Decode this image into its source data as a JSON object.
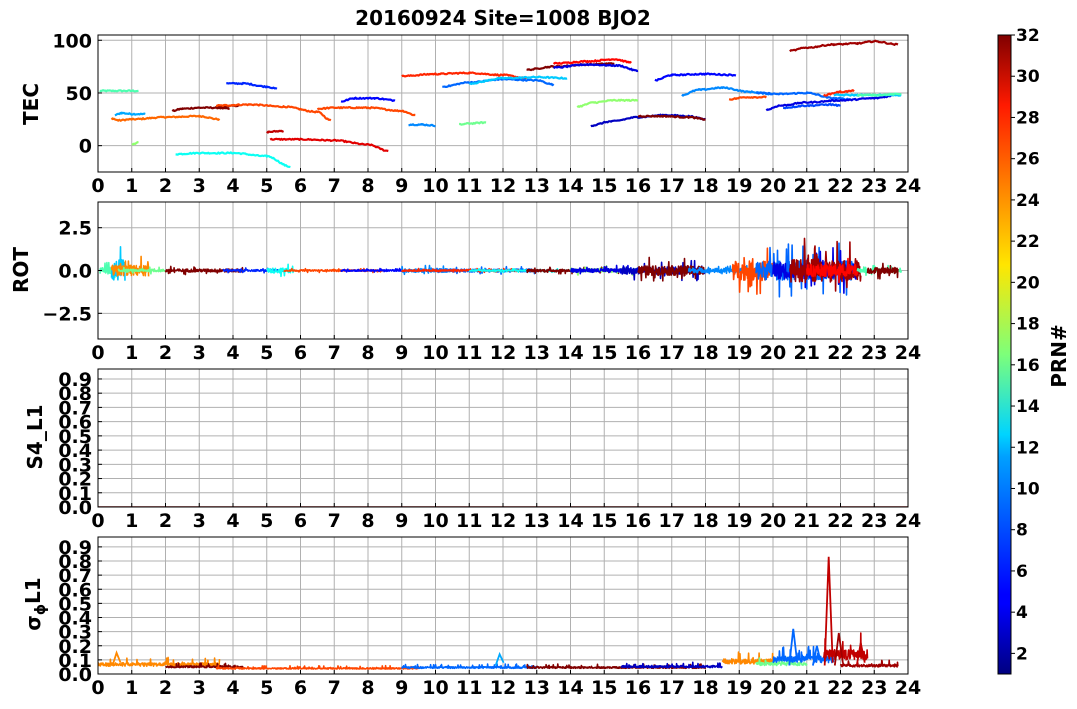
{
  "title": "20160924 Site=1008 BJO2",
  "colorbar": {
    "label": "PRN#",
    "ticks": [
      "2",
      "4",
      "6",
      "8",
      "10",
      "12",
      "14",
      "16",
      "18",
      "20",
      "22",
      "24",
      "26",
      "28",
      "30",
      "32"
    ],
    "range": [
      1,
      32
    ],
    "colormap": "jet"
  },
  "chart_data": [
    {
      "type": "line",
      "ylabel": "TEC",
      "xlim": [
        0,
        24
      ],
      "ylim": [
        -25,
        105
      ],
      "x_ticks": [
        "0",
        "1",
        "2",
        "3",
        "4",
        "5",
        "6",
        "7",
        "8",
        "9",
        "10",
        "11",
        "12",
        "13",
        "14",
        "15",
        "16",
        "17",
        "18",
        "19",
        "20",
        "21",
        "22",
        "23",
        "24"
      ],
      "y_ticks": [
        {
          "v": 0,
          "t": "0"
        },
        {
          "v": 50,
          "t": "50"
        },
        {
          "v": 100,
          "t": "100"
        }
      ],
      "grid": true,
      "series": [
        {
          "prn": 15,
          "x": [
            0.05,
            1.2
          ],
          "y": [
            52,
            52
          ]
        },
        {
          "prn": 17,
          "x": [
            1.0,
            1.2
          ],
          "y": [
            1,
            3
          ]
        },
        {
          "prn": 10,
          "x": [
            0.5,
            0.7,
            1.0,
            1.4
          ],
          "y": [
            29,
            31,
            30,
            30
          ]
        },
        {
          "prn": 25,
          "x": [
            0.4,
            0.6,
            1.0,
            2.0,
            3.0,
            3.6
          ],
          "y": [
            26,
            24,
            25,
            27,
            28,
            25
          ]
        },
        {
          "prn": 32,
          "x": [
            2.2,
            2.5,
            3.0,
            3.5,
            3.9
          ],
          "y": [
            33,
            35,
            36,
            36,
            35
          ]
        },
        {
          "prn": 32,
          "x": [
            3.5,
            4.2
          ],
          "y": [
            37,
            38
          ]
        },
        {
          "prn": 26,
          "x": [
            3.5,
            4.5,
            5.5,
            6.5,
            6.9
          ],
          "y": [
            38,
            39,
            37,
            32,
            24
          ]
        },
        {
          "prn": 13,
          "x": [
            2.3,
            3.0,
            4.0,
            5.0,
            5.7
          ],
          "y": [
            -8,
            -7,
            -7,
            -10,
            -20
          ]
        },
        {
          "prn": 6,
          "x": [
            3.8,
            4.3,
            5.0,
            5.3
          ],
          "y": [
            59,
            59,
            56,
            54
          ]
        },
        {
          "prn": 30,
          "x": [
            5.0,
            5.5
          ],
          "y": [
            13,
            14
          ]
        },
        {
          "prn": 29,
          "x": [
            5.1,
            6.0,
            7.0,
            8.0,
            8.6
          ],
          "y": [
            6,
            6,
            5,
            1,
            -5
          ]
        },
        {
          "prn": 26,
          "x": [
            6.5,
            7.0,
            8.0,
            9.0,
            9.4
          ],
          "y": [
            35,
            36,
            36,
            33,
            29
          ]
        },
        {
          "prn": 5,
          "x": [
            7.2,
            7.6,
            8.2,
            8.8
          ],
          "y": [
            42,
            45,
            45,
            43
          ]
        },
        {
          "prn": 9,
          "x": [
            9.2,
            9.6,
            10.0
          ],
          "y": [
            20,
            20,
            19
          ]
        },
        {
          "prn": 27,
          "x": [
            9.0,
            10.0,
            11.0,
            12.0,
            12.7
          ],
          "y": [
            66,
            68,
            69,
            67,
            64
          ]
        },
        {
          "prn": 16,
          "x": [
            10.7,
            11.0,
            11.5
          ],
          "y": [
            20,
            21,
            22
          ]
        },
        {
          "prn": 8,
          "x": [
            10.2,
            11.0,
            12.0,
            13.0,
            13.5
          ],
          "y": [
            56,
            60,
            63,
            62,
            58
          ]
        },
        {
          "prn": 11,
          "x": [
            11.0,
            12.0,
            13.0,
            13.9
          ],
          "y": [
            59,
            64,
            65,
            64
          ]
        },
        {
          "prn": 32,
          "x": [
            12.7,
            13.5,
            14.5,
            15.3
          ],
          "y": [
            72,
            75,
            77,
            78
          ]
        },
        {
          "prn": 28,
          "x": [
            13.5,
            14.5,
            15.3,
            15.8
          ],
          "y": [
            78,
            80,
            82,
            79
          ]
        },
        {
          "prn": 4,
          "x": [
            13.5,
            14.5,
            15.4,
            16.0
          ],
          "y": [
            74,
            77,
            76,
            71
          ]
        },
        {
          "prn": 17,
          "x": [
            14.2,
            14.7,
            15.3,
            16.0
          ],
          "y": [
            37,
            41,
            43,
            43
          ]
        },
        {
          "prn": 3,
          "x": [
            14.6,
            15.2,
            16.0,
            16.8,
            17.5,
            18.0
          ],
          "y": [
            19,
            23,
            27,
            29,
            28,
            25
          ]
        },
        {
          "prn": 32,
          "x": [
            16.0,
            16.7,
            17.5,
            18.0
          ],
          "y": [
            28,
            28,
            27,
            25
          ]
        },
        {
          "prn": 5,
          "x": [
            16.5,
            17.0,
            18.0,
            18.9
          ],
          "y": [
            62,
            67,
            68,
            67
          ]
        },
        {
          "prn": 9,
          "x": [
            17.3,
            17.8,
            18.5,
            19.3,
            20.0
          ],
          "y": [
            48,
            53,
            55,
            51,
            49
          ]
        },
        {
          "prn": 26,
          "x": [
            18.7,
            19.2,
            19.8
          ],
          "y": [
            44,
            46,
            46
          ]
        },
        {
          "prn": 8,
          "x": [
            19.5,
            20.2,
            21.0,
            21.8,
            22.3
          ],
          "y": [
            50,
            49,
            50,
            45,
            44
          ]
        },
        {
          "prn": 4,
          "x": [
            19.8,
            20.2,
            21.0,
            22.0,
            23.0,
            23.5
          ],
          "y": [
            34,
            38,
            41,
            43,
            45,
            47
          ]
        },
        {
          "prn": 7,
          "x": [
            20.3,
            21.0,
            21.7,
            22.0
          ],
          "y": [
            36,
            38,
            39,
            38
          ]
        },
        {
          "prn": 31,
          "x": [
            20.5,
            21.0,
            21.8,
            22.5,
            23.0,
            23.7
          ],
          "y": [
            90,
            93,
            96,
            97,
            99,
            96
          ]
        },
        {
          "prn": 27,
          "x": [
            21.5,
            22.0,
            22.4
          ],
          "y": [
            48,
            51,
            52
          ]
        },
        {
          "prn": 11,
          "x": [
            21.8,
            22.5,
            23.2,
            23.8
          ],
          "y": [
            48,
            48,
            48,
            48
          ]
        },
        {
          "prn": 15,
          "x": [
            22.5,
            23.0,
            23.8
          ],
          "y": [
            48,
            48,
            49
          ]
        }
      ]
    },
    {
      "type": "line",
      "ylabel": "ROT",
      "xlim": [
        0,
        24
      ],
      "ylim": [
        -4,
        4
      ],
      "x_ticks": [
        "0",
        "1",
        "2",
        "3",
        "4",
        "5",
        "6",
        "7",
        "8",
        "9",
        "10",
        "11",
        "12",
        "13",
        "14",
        "15",
        "16",
        "17",
        "18",
        "19",
        "20",
        "21",
        "22",
        "23",
        "24"
      ],
      "y_ticks": [
        {
          "v": 2.5,
          "t": "2.5"
        },
        {
          "v": 0,
          "t": "0.0"
        },
        {
          "v": -2.5,
          "t": "−2.5"
        }
      ],
      "grid": true,
      "series": [
        {
          "prn": 15,
          "segment": [
            0.05,
            0.6
          ],
          "amp": 0.5
        },
        {
          "prn": 11,
          "segment": [
            0.4,
            0.8
          ],
          "amp": 1.8
        },
        {
          "prn": 24,
          "segment": [
            0.4,
            1.5
          ],
          "amp": 0.9
        },
        {
          "prn": 16,
          "segment": [
            0.6,
            2.0
          ],
          "amp": 0.2
        },
        {
          "prn": 32,
          "segment": [
            2.0,
            4.3
          ],
          "amp": 0.25
        },
        {
          "prn": 6,
          "segment": [
            3.7,
            5.5
          ],
          "amp": 0.15
        },
        {
          "prn": 13,
          "segment": [
            5.0,
            5.8
          ],
          "amp": 0.4
        },
        {
          "prn": 26,
          "segment": [
            5.5,
            8.5
          ],
          "amp": 0.12
        },
        {
          "prn": 5,
          "segment": [
            7.2,
            9.0
          ],
          "amp": 0.12
        },
        {
          "prn": 9,
          "segment": [
            9.0,
            10.5
          ],
          "amp": 0.3
        },
        {
          "prn": 8,
          "segment": [
            10.0,
            13.0
          ],
          "amp": 0.25
        },
        {
          "prn": 27,
          "segment": [
            9.0,
            12.5
          ],
          "amp": 0.12
        },
        {
          "prn": 13,
          "segment": [
            11.0,
            14.0
          ],
          "amp": 0.12
        },
        {
          "prn": 32,
          "segment": [
            12.7,
            15.5
          ],
          "amp": 0.2
        },
        {
          "prn": 17,
          "segment": [
            14.0,
            16.0
          ],
          "amp": 0.3
        },
        {
          "prn": 4,
          "segment": [
            14.0,
            16.0
          ],
          "amp": 0.3
        },
        {
          "prn": 3,
          "segment": [
            15.5,
            18.0
          ],
          "amp": 0.6
        },
        {
          "prn": 32,
          "segment": [
            16.0,
            18.0
          ],
          "amp": 0.8
        },
        {
          "prn": 9,
          "segment": [
            17.5,
            19.5
          ],
          "amp": 0.35
        },
        {
          "prn": 26,
          "segment": [
            18.8,
            20.0
          ],
          "amp": 1.6
        },
        {
          "prn": 8,
          "segment": [
            19.5,
            22.5
          ],
          "amp": 1.6
        },
        {
          "prn": 4,
          "segment": [
            20.0,
            22.5
          ],
          "amp": 1.4
        },
        {
          "prn": 31,
          "segment": [
            20.5,
            22.6
          ],
          "amp": 1.9
        },
        {
          "prn": 28,
          "segment": [
            21.0,
            22.5
          ],
          "amp": 1.0
        },
        {
          "prn": 15,
          "segment": [
            22.5,
            23.8
          ],
          "amp": 0.3
        },
        {
          "prn": 32,
          "segment": [
            22.8,
            23.7
          ],
          "amp": 0.5
        }
      ]
    },
    {
      "type": "line",
      "ylabel": "S4_L1",
      "xlim": [
        0,
        24
      ],
      "ylim": [
        0,
        0.97
      ],
      "x_ticks": [
        "0",
        "1",
        "2",
        "3",
        "4",
        "5",
        "6",
        "7",
        "8",
        "9",
        "10",
        "11",
        "12",
        "13",
        "14",
        "15",
        "16",
        "17",
        "18",
        "19",
        "20",
        "21",
        "22",
        "23",
        "24"
      ],
      "y_ticks": [
        {
          "v": 0,
          "t": "0.0"
        },
        {
          "v": 0.1,
          "t": "0.1"
        },
        {
          "v": 0.2,
          "t": "0.2"
        },
        {
          "v": 0.3,
          "t": "0.3"
        },
        {
          "v": 0.4,
          "t": "0.4"
        },
        {
          "v": 0.5,
          "t": "0.5"
        },
        {
          "v": 0.6,
          "t": "0.6"
        },
        {
          "v": 0.7,
          "t": "0.7"
        },
        {
          "v": 0.8,
          "t": "0.8"
        },
        {
          "v": 0.9,
          "t": "0.9"
        }
      ],
      "grid": true,
      "series": [
        {
          "prn": 32,
          "x": [
            0.0,
            24.0
          ],
          "y": [
            0.0,
            0.0
          ]
        }
      ]
    },
    {
      "type": "line",
      "ylabel": "σφL1",
      "xlim": [
        0,
        24
      ],
      "ylim": [
        0,
        0.97
      ],
      "x_ticks": [
        "0",
        "1",
        "2",
        "3",
        "4",
        "5",
        "6",
        "7",
        "8",
        "9",
        "10",
        "11",
        "12",
        "13",
        "14",
        "15",
        "16",
        "17",
        "18",
        "19",
        "20",
        "21",
        "22",
        "23",
        "24"
      ],
      "y_ticks": [
        {
          "v": 0,
          "t": "0.0"
        },
        {
          "v": 0.1,
          "t": "0.1"
        },
        {
          "v": 0.2,
          "t": "0.2"
        },
        {
          "v": 0.3,
          "t": "0.3"
        },
        {
          "v": 0.4,
          "t": "0.4"
        },
        {
          "v": 0.5,
          "t": "0.5"
        },
        {
          "v": 0.6,
          "t": "0.6"
        },
        {
          "v": 0.7,
          "t": "0.7"
        },
        {
          "v": 0.8,
          "t": "0.8"
        },
        {
          "v": 0.9,
          "t": "0.9"
        }
      ],
      "grid": true,
      "spikes": [
        {
          "prn": 24,
          "x": 0.55,
          "y": 0.15
        },
        {
          "prn": 10,
          "x": 11.9,
          "y": 0.14
        },
        {
          "prn": 8,
          "x": 20.6,
          "y": 0.32
        },
        {
          "prn": 8,
          "x": 21.3,
          "y": 0.2
        },
        {
          "prn": 30,
          "x": 21.65,
          "y": 0.83
        },
        {
          "prn": 31,
          "x": 21.95,
          "y": 0.29
        },
        {
          "prn": 30,
          "x": 22.6,
          "y": 0.22
        }
      ],
      "series": [
        {
          "prn": 24,
          "segment": [
            0.0,
            3.6
          ],
          "base": 0.055,
          "amp": 0.04
        },
        {
          "prn": 32,
          "segment": [
            2.0,
            4.3
          ],
          "base": 0.045,
          "amp": 0.02
        },
        {
          "prn": 26,
          "segment": [
            3.5,
            9.5
          ],
          "base": 0.035,
          "amp": 0.015
        },
        {
          "prn": 8,
          "segment": [
            9.0,
            13.0
          ],
          "base": 0.04,
          "amp": 0.02
        },
        {
          "prn": 32,
          "segment": [
            12.7,
            18.0
          ],
          "base": 0.04,
          "amp": 0.02
        },
        {
          "prn": 3,
          "segment": [
            15.5,
            18.5
          ],
          "base": 0.045,
          "amp": 0.025
        },
        {
          "prn": 24,
          "segment": [
            18.5,
            20.0
          ],
          "base": 0.07,
          "amp": 0.06
        },
        {
          "prn": 16,
          "segment": [
            19.5,
            21.0
          ],
          "base": 0.06,
          "amp": 0.04
        },
        {
          "prn": 8,
          "segment": [
            20.0,
            21.8
          ],
          "base": 0.08,
          "amp": 0.08
        },
        {
          "prn": 30,
          "segment": [
            21.5,
            22.8
          ],
          "base": 0.1,
          "amp": 0.12
        },
        {
          "prn": 31,
          "segment": [
            22.0,
            23.7
          ],
          "base": 0.05,
          "amp": 0.03
        }
      ]
    }
  ]
}
